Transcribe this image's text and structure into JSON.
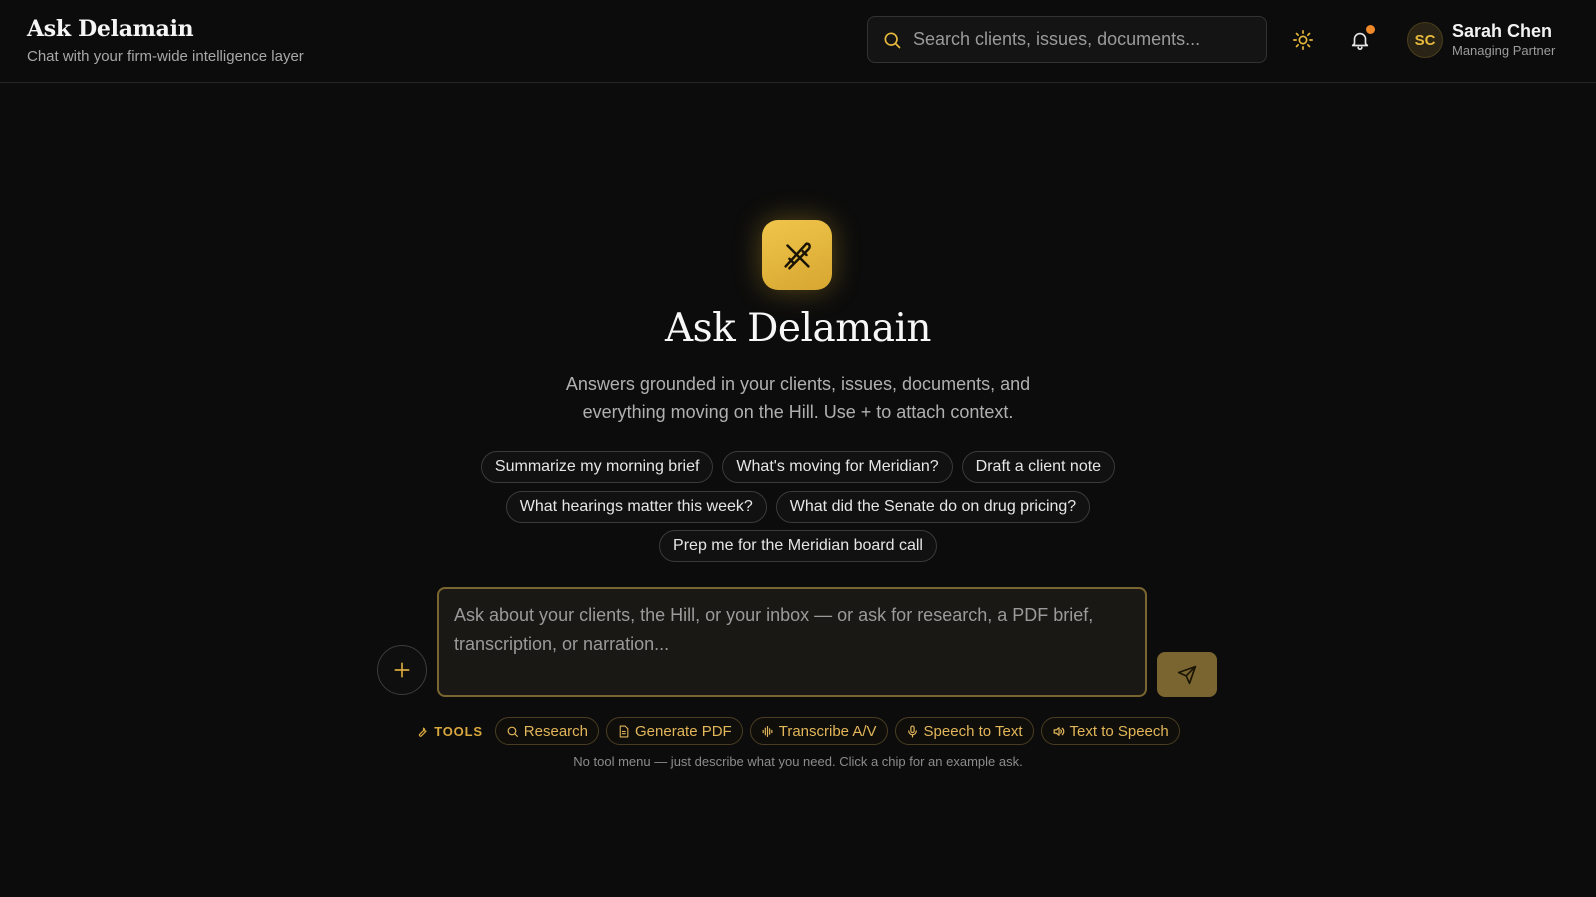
{
  "header": {
    "title": "Ask Delamain",
    "subtitle": "Chat with your firm-wide intelligence layer",
    "search_placeholder": "Search clients, issues, documents...",
    "theme_icon": "sun-icon",
    "notification_icon": "bell-icon",
    "notification_dot_color": "#f0892a",
    "user": {
      "initials": "SC",
      "name": "Sarah Chen",
      "role": "Managing Partner"
    }
  },
  "hero": {
    "logo_icon": "quill-cross-icon",
    "title": "Ask Delamain",
    "description": "Answers grounded in your clients, issues, documents, and everything moving on the Hill. Use + to attach context."
  },
  "suggestions": [
    [
      "Summarize my morning brief",
      "What's moving for Meridian?",
      "Draft a client note"
    ],
    [
      "What hearings matter this week?",
      "What did the Senate do on drug pricing?"
    ],
    [
      "Prep me for the Meridian board call"
    ]
  ],
  "composer": {
    "placeholder": "Ask about your clients, the Hill, or your inbox — or ask for research, a PDF brief, transcription, or narration...",
    "attach_icon": "plus-icon",
    "send_icon": "send-icon"
  },
  "tools": {
    "label": "TOOLS",
    "label_icon": "wrench-icon",
    "items": [
      {
        "label": "Research",
        "icon": "search-icon"
      },
      {
        "label": "Generate PDF",
        "icon": "document-icon"
      },
      {
        "label": "Transcribe A/V",
        "icon": "waveform-icon"
      },
      {
        "label": "Speech to Text",
        "icon": "microphone-icon"
      },
      {
        "label": "Text to Speech",
        "icon": "speaker-icon"
      }
    ],
    "hint": "No tool menu — just describe what you need. Click a chip for an example ask."
  },
  "colors": {
    "accent": "#e7b93c",
    "background": "#0c0c0c",
    "send_button": "#7a6530"
  }
}
